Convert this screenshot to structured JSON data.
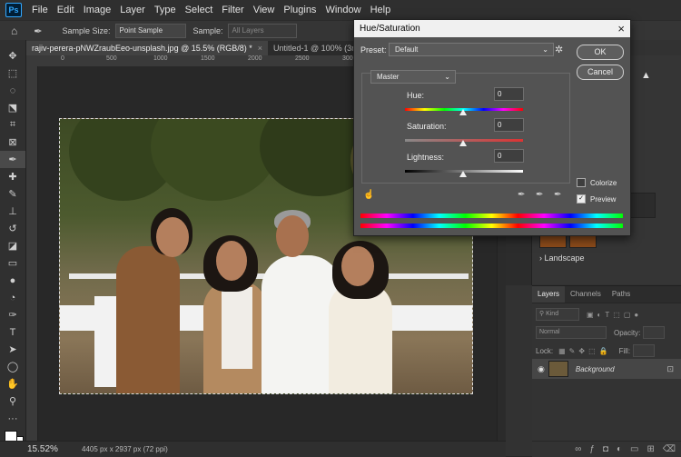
{
  "app": {
    "logo": "Ps"
  },
  "menu": [
    "File",
    "Edit",
    "Image",
    "Layer",
    "Type",
    "Select",
    "Filter",
    "View",
    "Plugins",
    "Window",
    "Help"
  ],
  "options": {
    "sample_size_label": "Sample Size:",
    "sample_size_value": "Point Sample",
    "sample_label": "Sample:",
    "sample_value": "All Layers"
  },
  "tabs": [
    {
      "label": "rajiv-perera-pNWZraubEeo-unsplash.jpg @ 15.5% (RGB/8) *",
      "close": "×"
    },
    {
      "label": "Untitled-1 @ 100% (3rd, RGB/8#) *",
      "close": "×"
    }
  ],
  "ruler": {
    "h": [
      "0",
      "500",
      "1000",
      "1500",
      "2000",
      "2500",
      "3000",
      "3500"
    ]
  },
  "status": {
    "zoom": "15.52%",
    "doc": "4405 px x 2937 px (72 ppi)"
  },
  "dialog": {
    "title": "Hue/Saturation",
    "close": "×",
    "preset_label": "Preset:",
    "preset_value": "Default",
    "ok": "OK",
    "cancel": "Cancel",
    "channel": "Master",
    "hue_label": "Hue:",
    "hue_value": "0",
    "saturation_label": "Saturation:",
    "saturation_value": "0",
    "lightness_label": "Lightness:",
    "lightness_value": "0",
    "colorize_label": "Colorize",
    "preview_label": "Preview",
    "preview_check": "✓"
  },
  "panels": {
    "landscape": "Landscape",
    "layer_tabs": [
      "Layers",
      "Channels",
      "Paths"
    ],
    "kind": "Kind",
    "blend": "Normal",
    "opacity_label": "Opacity:",
    "lock_label": "Lock:",
    "fill_label": "Fill:",
    "layer_name": "Background"
  },
  "colors": {
    "accent": "#31a8ff",
    "dialog_bg": "#535353"
  },
  "icons": [
    "eyedropper-icon",
    "move-icon",
    "marquee-icon",
    "lasso-icon",
    "crop-icon",
    "brush-icon",
    "type-icon",
    "hand-icon",
    "zoom-icon",
    "gear-icon",
    "warning-icon",
    "eye-icon",
    "lock-icon"
  ]
}
